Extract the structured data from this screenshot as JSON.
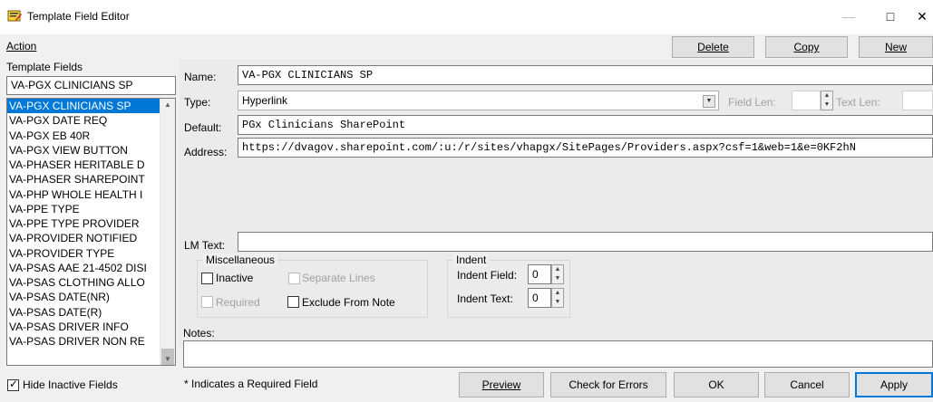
{
  "window": {
    "title": "Template Field Editor",
    "minimize": "—",
    "maximize": "□",
    "close": "✕"
  },
  "menu": {
    "action": "Action"
  },
  "toolbar": {
    "delete": "Delete",
    "copy": "Copy",
    "new": "New"
  },
  "template_fields": {
    "header": "Template Fields",
    "search_value": "VA-PGX CLINICIANS SP",
    "items": [
      "VA-PGX CLINICIANS SP",
      "VA-PGX DATE REQ",
      "VA-PGX EB 40R",
      "VA-PGX VIEW BUTTON",
      "VA-PHASER HERITABLE D",
      "VA-PHASER SHAREPOINT",
      "VA-PHP WHOLE HEALTH I",
      "VA-PPE TYPE",
      "VA-PPE TYPE PROVIDER",
      "VA-PROVIDER NOTIFIED",
      "VA-PROVIDER TYPE",
      "VA-PSAS AAE 21-4502 DISI",
      "VA-PSAS CLOTHING ALLO",
      "VA-PSAS DATE(NR)",
      "VA-PSAS DATE(R)",
      "VA-PSAS DRIVER INFO",
      "VA-PSAS DRIVER NON RE"
    ],
    "selected_index": 0
  },
  "editor": {
    "name_label": "Name:",
    "name_value": "VA-PGX CLINICIANS SP",
    "type_label": "Type:",
    "type_value": "Hyperlink",
    "field_len_label": "Field Len:",
    "text_len_label": "Text Len:",
    "default_label": "Default:",
    "default_value": "PGx Clinicians SharePoint",
    "address_label": "Address:",
    "address_value": "https://dvagov.sharepoint.com/:u:/r/sites/vhapgx/SitePages/Providers.aspx?csf=1&web=1&e=0KF2hN",
    "lm_text_label": "LM Text:",
    "lm_text_value": ""
  },
  "misc": {
    "group_label": "Miscellaneous",
    "inactive": "Inactive",
    "separate_lines": "Separate Lines",
    "required": "Required",
    "exclude_from_note": "Exclude From Note"
  },
  "indent": {
    "group_label": "Indent",
    "indent_field_label": "Indent Field:",
    "indent_field_value": "0",
    "indent_text_label": "Indent Text:",
    "indent_text_value": "0"
  },
  "notes": {
    "label": "Notes:",
    "value": ""
  },
  "footer": {
    "hide_inactive": "Hide Inactive Fields",
    "hide_inactive_checked": true,
    "required_note": "* Indicates a Required Field",
    "preview": "Preview",
    "check_errors": "Check for Errors",
    "ok": "OK",
    "cancel": "Cancel",
    "apply": "Apply"
  },
  "icons": {
    "title_icon": "template-editor-icon",
    "check": "✓"
  }
}
